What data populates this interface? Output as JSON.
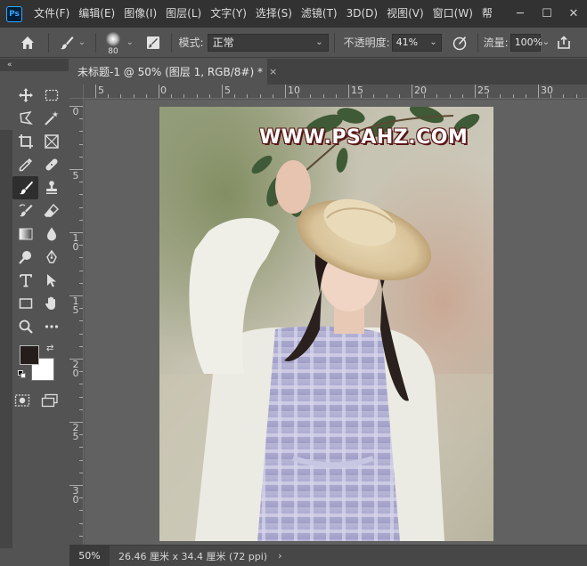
{
  "app": {
    "logo_text": "Ps"
  },
  "menu": {
    "items": [
      "文件(F)",
      "编辑(E)",
      "图像(I)",
      "图层(L)",
      "文字(Y)",
      "选择(S)",
      "滤镜(T)",
      "3D(D)",
      "视图(V)",
      "窗口(W)",
      "帮"
    ]
  },
  "window_controls": {
    "minimize": "─",
    "maximize": "☐",
    "close": "✕"
  },
  "options": {
    "brush_size": "80",
    "mode_label": "模式:",
    "mode_value": "正常",
    "opacity_label": "不透明度:",
    "opacity_value": "41%",
    "flow_label": "流量:",
    "flow_value": "100%"
  },
  "toolbar": {
    "collapse": "«"
  },
  "document": {
    "tab_title": "未标题-1 @ 50% (图层 1, RGB/8#) *",
    "close": "×",
    "watermark": "WWW.PSAHZ.COM"
  },
  "ruler": {
    "top": [
      {
        "label": "5"
      },
      {
        "label": "0"
      },
      {
        "label": "5"
      },
      {
        "label": "10"
      },
      {
        "label": "15"
      },
      {
        "label": "20"
      },
      {
        "label": "25"
      },
      {
        "label": "30"
      }
    ],
    "left": [
      {
        "label": "0"
      },
      {
        "label": "5"
      },
      {
        "label": "1 0"
      },
      {
        "label": "1 5"
      },
      {
        "label": "2 0"
      },
      {
        "label": "2 5"
      },
      {
        "label": "3 0"
      }
    ]
  },
  "status": {
    "zoom": "50%",
    "doc_size": "26.46 厘米 x 34.4 厘米 (72 ppi)",
    "arrow": "›"
  },
  "colors": {
    "foreground": "#241d1c",
    "background": "#ffffff",
    "watermark_stroke": "#5a1616"
  }
}
